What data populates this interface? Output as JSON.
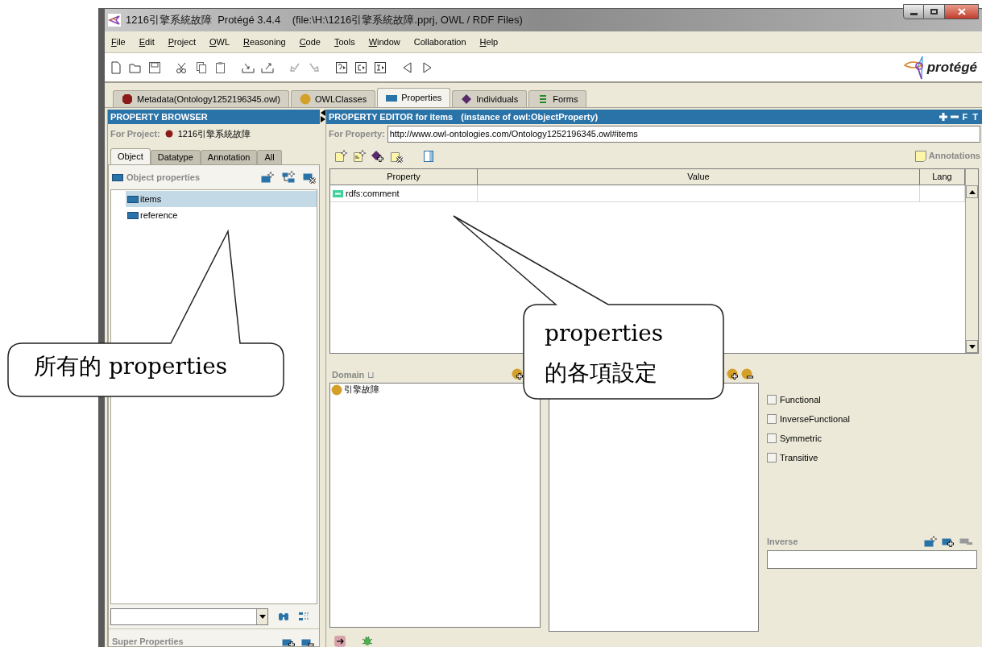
{
  "window": {
    "title": "1216引擎系統故障  Protégé 3.4.4    (file:\\H:\\1216引擎系統故障.pprj, OWL / RDF Files)"
  },
  "menu": [
    {
      "label": "File",
      "mnemonic": true
    },
    {
      "label": "Edit",
      "mnemonic": true
    },
    {
      "label": "Project",
      "mnemonic": true
    },
    {
      "label": "OWL",
      "mnemonic": true
    },
    {
      "label": "Reasoning",
      "mnemonic": true
    },
    {
      "label": "Code",
      "mnemonic": true
    },
    {
      "label": "Tools",
      "mnemonic": true
    },
    {
      "label": "Window",
      "mnemonic": true
    },
    {
      "label": "Collaboration",
      "mnemonic": false
    },
    {
      "label": "Help",
      "mnemonic": true
    }
  ],
  "logo": {
    "text": "protégé"
  },
  "tabs": [
    {
      "label": "Metadata(Ontology1252196345.owl)",
      "kind": "metadata",
      "selected": false
    },
    {
      "label": "OWLClasses",
      "kind": "class",
      "selected": false
    },
    {
      "label": "Properties",
      "kind": "property",
      "selected": true
    },
    {
      "label": "Individuals",
      "kind": "individual",
      "selected": false
    },
    {
      "label": "Forms",
      "kind": "form",
      "selected": false
    }
  ],
  "property_browser": {
    "title": "PROPERTY BROWSER",
    "project_label": "For Project:",
    "project_name": "1216引擎系統故障",
    "tabs": [
      {
        "label": "Object",
        "selected": true
      },
      {
        "label": "Datatype",
        "selected": false
      },
      {
        "label": "Annotation",
        "selected": false
      },
      {
        "label": "All",
        "selected": false
      }
    ],
    "section_title": "Object properties",
    "items": [
      {
        "label": "items",
        "selected": true
      },
      {
        "label": "reference",
        "selected": false
      }
    ],
    "super_properties_title": "Super Properties"
  },
  "property_editor": {
    "title": "PROPERTY EDITOR for items",
    "subtitle": "(instance of owl:ObjectProperty)",
    "header_letters": [
      "F",
      "T"
    ],
    "property_label": "For Property:",
    "property_uri": "http://www.owl-ontologies.com/Ontology1252196345.owl#items",
    "annotations_label": "Annotations",
    "table": {
      "columns": [
        "Property",
        "Value",
        "Lang"
      ],
      "rows": [
        {
          "property": "rdfs:comment"
        }
      ]
    },
    "domain": {
      "label": "Domain",
      "operator": "⊔",
      "items": [
        "引擎故障"
      ]
    },
    "characteristics": [
      {
        "label": "Functional",
        "checked": false
      },
      {
        "label": "InverseFunctional",
        "checked": false
      },
      {
        "label": "Symmetric",
        "checked": false
      },
      {
        "label": "Transitive",
        "checked": false
      }
    ],
    "inverse": {
      "label": "Inverse"
    }
  },
  "callouts": [
    {
      "lines": [
        "所有的 properties"
      ]
    },
    {
      "lines": [
        "properties",
        "的各項設定"
      ]
    }
  ]
}
